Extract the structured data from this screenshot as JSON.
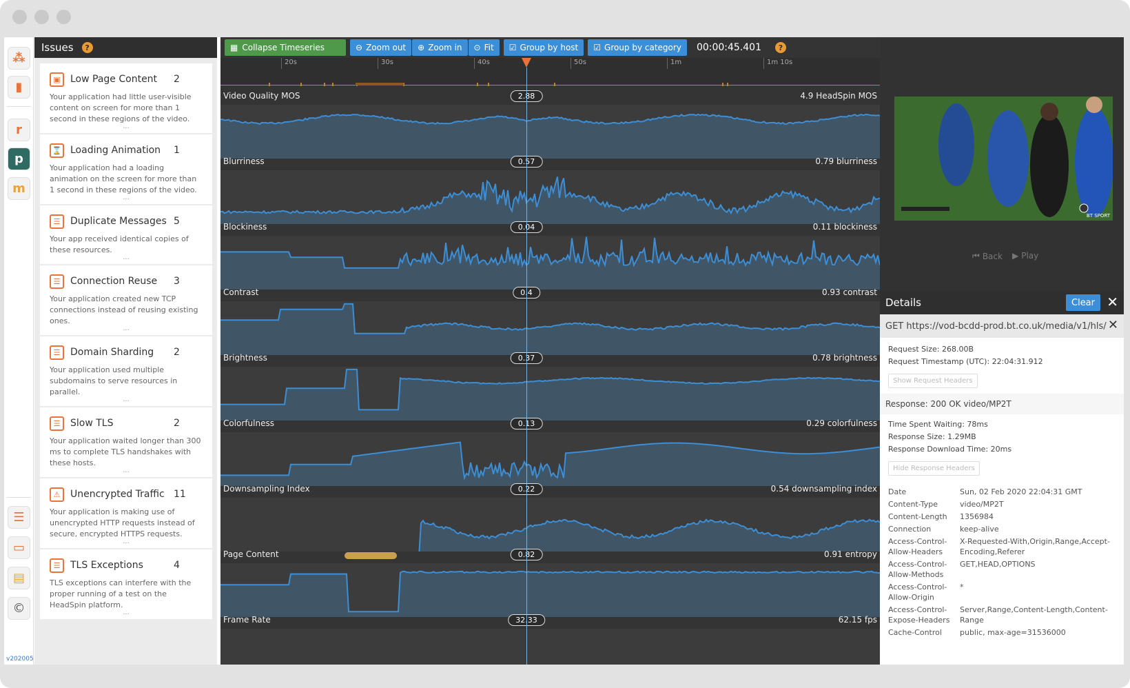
{
  "issues": {
    "title": "Issues",
    "help": "?",
    "more": "...",
    "items": [
      {
        "icon": "low-content-icon",
        "glyph": "▣",
        "title": "Low Page Content",
        "count": "2",
        "desc": "Your application had little user-visible content on screen for more than 1 second in these regions of the video."
      },
      {
        "icon": "loading-icon",
        "glyph": "⌛",
        "title": "Loading Animation",
        "count": "1",
        "desc": "Your application had a loading animation on the screen for more than 1 second in these regions of the video."
      },
      {
        "icon": "server-icon",
        "glyph": "☰",
        "title": "Duplicate Messages",
        "count": "5",
        "desc": "Your app received identical copies of these resources."
      },
      {
        "icon": "server-icon",
        "glyph": "☰",
        "title": "Connection Reuse",
        "count": "3",
        "desc": "Your application created new TCP connections instead of reusing existing ones."
      },
      {
        "icon": "server-icon",
        "glyph": "☰",
        "title": "Domain Sharding",
        "count": "2",
        "desc": "Your application used multiple subdomains to serve resources in parallel."
      },
      {
        "icon": "server-icon",
        "glyph": "☰",
        "title": "Slow TLS",
        "count": "2",
        "desc": "Your application waited longer than 300 ms to complete TLS handshakes with these hosts."
      },
      {
        "icon": "warning-icon",
        "glyph": "⚠",
        "title": "Unencrypted Traffic",
        "count": "11",
        "desc": "Your application is making use of unencrypted HTTP requests instead of secure, encrypted HTTPS requests."
      },
      {
        "icon": "server-icon",
        "glyph": "☰",
        "title": "TLS Exceptions",
        "count": "4",
        "desc": "TLS exceptions can interfere with the proper running of a test on the HeadSpin platform."
      }
    ]
  },
  "rail": {
    "version": "v202005"
  },
  "toolbar": {
    "collapse": "Collapse Timeseries",
    "zoom_out": "Zoom out",
    "zoom_in": "Zoom in",
    "fit": "Fit",
    "group_host": "Group by host",
    "group_category": "Group by category",
    "timecode": "00:00:45.401"
  },
  "axis": {
    "ticks": [
      "20s",
      "30s",
      "40s",
      "50s",
      "1m",
      "1m 10s"
    ]
  },
  "series": [
    {
      "name": "Video Quality MOS",
      "value": "2.88",
      "max": "4.9 HeadSpin MOS"
    },
    {
      "name": "Blurriness",
      "value": "0.57",
      "max": "0.79 blurriness"
    },
    {
      "name": "Blockiness",
      "value": "0.04",
      "max": "0.11 blockiness"
    },
    {
      "name": "Contrast",
      "value": "0.4",
      "max": "0.93 contrast"
    },
    {
      "name": "Brightness",
      "value": "0.37",
      "max": "0.78 brightness"
    },
    {
      "name": "Colorfulness",
      "value": "0.13",
      "max": "0.29 colorfulness"
    },
    {
      "name": "Downsampling Index",
      "value": "0.22",
      "max": "0.54 downsampling index"
    },
    {
      "name": "Page Content",
      "value": "0.82",
      "max": "0.91 entropy"
    },
    {
      "name": "Frame Rate",
      "value": "32.33",
      "max": "62.15 fps"
    }
  ],
  "video": {
    "back": "Back",
    "play": "Play",
    "badge": "BT SPORT"
  },
  "details": {
    "title": "Details",
    "clear": "Clear",
    "request_line": "GET https://vod-bcdd-prod.bt.co.uk/media/v1/hls/",
    "request_size": "Request Size: 268.00B",
    "request_timestamp": "Request Timestamp (UTC): 22:04:31.912",
    "show_req_headers": "Show Request Headers",
    "response": "Response: 200 OK video/MP2T",
    "time_waiting": "Time Spent Waiting: 78ms",
    "response_size": "Response Size: 1.29MB",
    "download_time": "Response Download Time: 20ms",
    "hide_resp_headers": "Hide Response Headers",
    "headers": [
      {
        "k": "Date",
        "v": "Sun, 02 Feb 2020 22:04:31 GMT"
      },
      {
        "k": "Content-Type",
        "v": "video/MP2T"
      },
      {
        "k": "Content-Length",
        "v": "1356984"
      },
      {
        "k": "Connection",
        "v": "keep-alive"
      },
      {
        "k": "Access-Control-Allow-Headers",
        "v": "X-Requested-With,Origin,Range,Accept-Encoding,Referer"
      },
      {
        "k": "Access-Control-Allow-Methods",
        "v": "GET,HEAD,OPTIONS"
      },
      {
        "k": "Access-Control-Allow-Origin",
        "v": "*"
      },
      {
        "k": "Access-Control-Expose-Headers",
        "v": "Server,Range,Content-Length,Content-Range"
      },
      {
        "k": "Cache-Control",
        "v": "public, max-age=31536000"
      }
    ]
  }
}
